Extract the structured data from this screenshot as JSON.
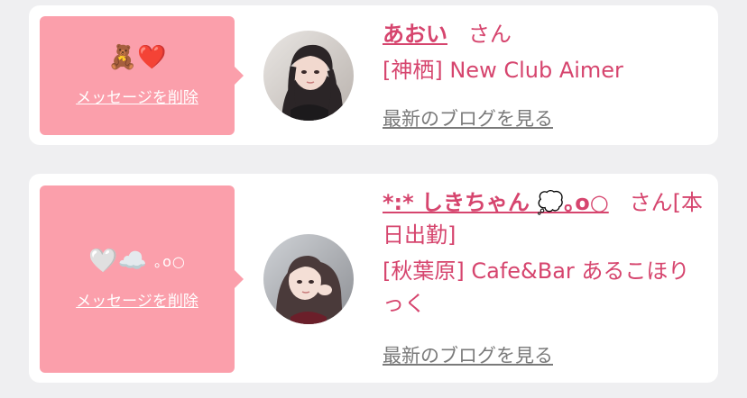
{
  "messages": [
    {
      "message_main": "🧸❤️",
      "message_sub": "",
      "delete_label": "メッセージを削除",
      "name": "あおい",
      "honorific": "さん",
      "shop": "[神栖] New Club Aimer",
      "blog_label": "最新のブログを見る",
      "avatar_icon": "girl-photo-avatar"
    },
    {
      "message_main": "🤍☁️",
      "message_sub": "｡o○",
      "delete_label": "メッセージを削除",
      "name": "*:* しきちゃん 💭｡o○",
      "honorific": "さん[本日出勤]",
      "shop": "[秋葉原] Cafe&Bar あるこほりっく",
      "blog_label": "最新のブログを見る",
      "avatar_icon": "girl-photo-avatar"
    }
  ],
  "colors": {
    "bubble": "#fb9fab",
    "accent_text": "#d6456e",
    "link_gray": "#7a7a7a",
    "background": "#efeff1"
  }
}
